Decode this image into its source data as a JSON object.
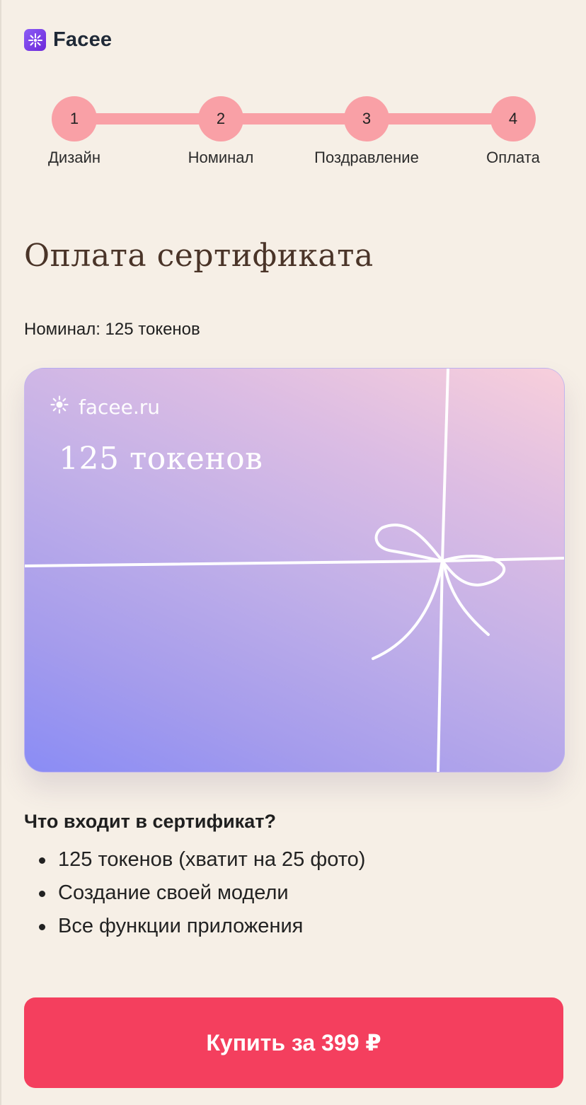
{
  "header": {
    "brand": "Facee",
    "logo_icon": "sparkle-icon"
  },
  "stepper": {
    "steps": [
      {
        "number": "1",
        "label": "Дизайн"
      },
      {
        "number": "2",
        "label": "Номинал"
      },
      {
        "number": "3",
        "label": "Поздравление"
      },
      {
        "number": "4",
        "label": "Оплата"
      }
    ],
    "color": "#f9a0a6"
  },
  "page": {
    "title": "Оплата сертификата",
    "nominal_label": "Номинал:",
    "nominal_value": "125 токенов"
  },
  "card": {
    "brand": "facee.ru",
    "brand_icon": "sun-icon",
    "amount": "125 токенов",
    "gradient_start": "#8a8cf5",
    "gradient_end": "#f8cfdb"
  },
  "includes": {
    "title": "Что входит в сертификат?",
    "items": [
      "125 токенов (хватит на 25 фото)",
      "Создание своей модели",
      "Все функции приложения"
    ]
  },
  "buy_button": {
    "label": "Купить за 399 ₽",
    "color": "#f43f5e"
  }
}
